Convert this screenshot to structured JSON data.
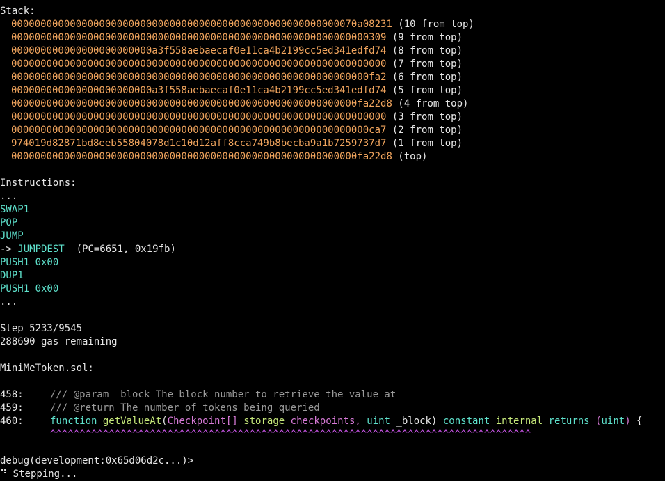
{
  "colors": {
    "background": "#000000",
    "text": "#e6e6e6",
    "stack_value": "#f0a45d",
    "opcode": "#5ee1cc",
    "comment": "#9a9a9a",
    "function_name": "#c6e87a",
    "type_name": "#d77ad7",
    "carets": "#c855e6"
  },
  "stack": {
    "header": "Stack:",
    "entries": [
      {
        "value": "00000000000000000000000000000000000000000000000000000000070a08231",
        "label": " (10 from top)"
      },
      {
        "value": "0000000000000000000000000000000000000000000000000000000000000309",
        "label": " (9 from top)"
      },
      {
        "value": "000000000000000000000000a3f558aebaecaf0e11ca4b2199cc5ed341edfd74",
        "label": " (8 from top)"
      },
      {
        "value": "0000000000000000000000000000000000000000000000000000000000000000",
        "label": " (7 from top)"
      },
      {
        "value": "0000000000000000000000000000000000000000000000000000000000000fa2",
        "label": " (6 from top)"
      },
      {
        "value": "000000000000000000000000a3f558aebaecaf0e11ca4b2199cc5ed341edfd74",
        "label": " (5 from top)"
      },
      {
        "value": "00000000000000000000000000000000000000000000000000000000000fa22d8",
        "label": " (4 from top)"
      },
      {
        "value": "0000000000000000000000000000000000000000000000000000000000000000",
        "label": " (3 from top)"
      },
      {
        "value": "0000000000000000000000000000000000000000000000000000000000000ca7",
        "label": " (2 from top)"
      },
      {
        "value": "974019d82871bd8eeb55804078d1c10d12aff8cca749b8becba9a1b7259737d7",
        "label": " (1 from top)"
      },
      {
        "value": "00000000000000000000000000000000000000000000000000000000000fa22d8",
        "label": " (top)"
      }
    ]
  },
  "instructions": {
    "header": "Instructions:",
    "ellipsis_before": "...",
    "items": [
      {
        "prefix": "",
        "text": "SWAP1",
        "suffix": ""
      },
      {
        "prefix": "",
        "text": "POP",
        "suffix": ""
      },
      {
        "prefix": "",
        "text": "JUMP",
        "suffix": ""
      },
      {
        "prefix": "-> ",
        "text": "JUMPDEST",
        "suffix": "  (PC=6651, 0x19fb)"
      },
      {
        "prefix": "",
        "text": "PUSH1 0x00",
        "suffix": ""
      },
      {
        "prefix": "",
        "text": "DUP1",
        "suffix": ""
      },
      {
        "prefix": "",
        "text": "PUSH1 0x00",
        "suffix": ""
      }
    ],
    "ellipsis_after": "..."
  },
  "status": {
    "step": "Step 5233/9545",
    "gas": "288690 gas remaining"
  },
  "source": {
    "filename": "MiniMeToken.sol:",
    "lines": [
      {
        "number": "458:",
        "comment": "/// @param _block The block number to retrieve the value at"
      },
      {
        "number": "459:",
        "comment": "/// @return The number of tokens being queried"
      }
    ],
    "current_line": {
      "number": "460:",
      "kw_function": "function",
      "fn_name": "getValueAt",
      "paren_open": "(",
      "type_checkpoint": "Checkpoint[]",
      "kw_storage": "storage",
      "param_checkpoints": "checkpoints,",
      "kw_uint": "uint",
      "param_block": "_block)",
      "kw_constant": "constant",
      "kw_internal": "internal",
      "kw_returns": "returns",
      "ret_open": "(",
      "ret_uint": "uint",
      "ret_close": ")",
      "brace": "{"
    },
    "carets": "^^^^^^^^^^^^^^^^^^^^^^^^^^^^^^^^^^^^^^^^^^^^^^^^^^^^^^^^^^^^^^^^^^^^^^^^^^^^^^^^^^"
  },
  "prompt": {
    "text": "debug(development:0x65d06d2c...)>",
    "stepping": "⠙ Stepping..."
  }
}
